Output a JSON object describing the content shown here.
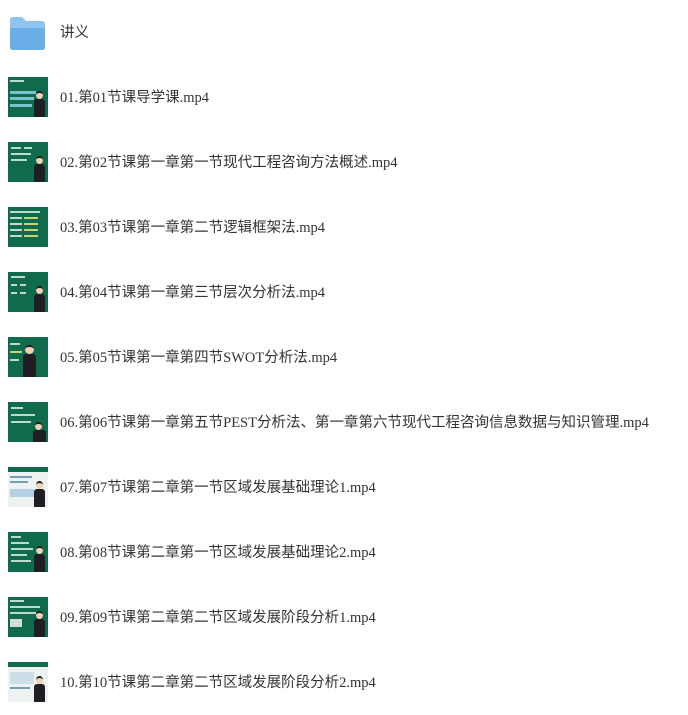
{
  "files": [
    {
      "type": "folder",
      "name": "讲义",
      "icon": "folder-icon"
    },
    {
      "type": "video",
      "name": "01.第01节课导学课.mp4",
      "icon": "video-thumbnail"
    },
    {
      "type": "video",
      "name": "02.第02节课第一章第一节现代工程咨询方法概述.mp4",
      "icon": "video-thumbnail"
    },
    {
      "type": "video",
      "name": "03.第03节课第一章第二节逻辑框架法.mp4",
      "icon": "video-thumbnail"
    },
    {
      "type": "video",
      "name": "04.第04节课第一章第三节层次分析法.mp4",
      "icon": "video-thumbnail"
    },
    {
      "type": "video",
      "name": "05.第05节课第一章第四节SWOT分析法.mp4",
      "icon": "video-thumbnail"
    },
    {
      "type": "video",
      "name": "06.第06节课第一章第五节PEST分析法、第一章第六节现代工程咨询信息数据与知识管理.mp4",
      "icon": "video-thumbnail"
    },
    {
      "type": "video",
      "name": "07.第07节课第二章第一节区域发展基础理论1.mp4",
      "icon": "video-thumbnail"
    },
    {
      "type": "video",
      "name": "08.第08节课第二章第一节区域发展基础理论2.mp4",
      "icon": "video-thumbnail"
    },
    {
      "type": "video",
      "name": "09.第09节课第二章第二节区域发展阶段分析1.mp4",
      "icon": "video-thumbnail"
    },
    {
      "type": "video",
      "name": "10.第10节课第二章第二节区域发展阶段分析2.mp4",
      "icon": "video-thumbnail"
    }
  ],
  "colors": {
    "text": "#333333",
    "folder": "#6aaee8",
    "thumbnail_board": "#0f6b4c"
  }
}
